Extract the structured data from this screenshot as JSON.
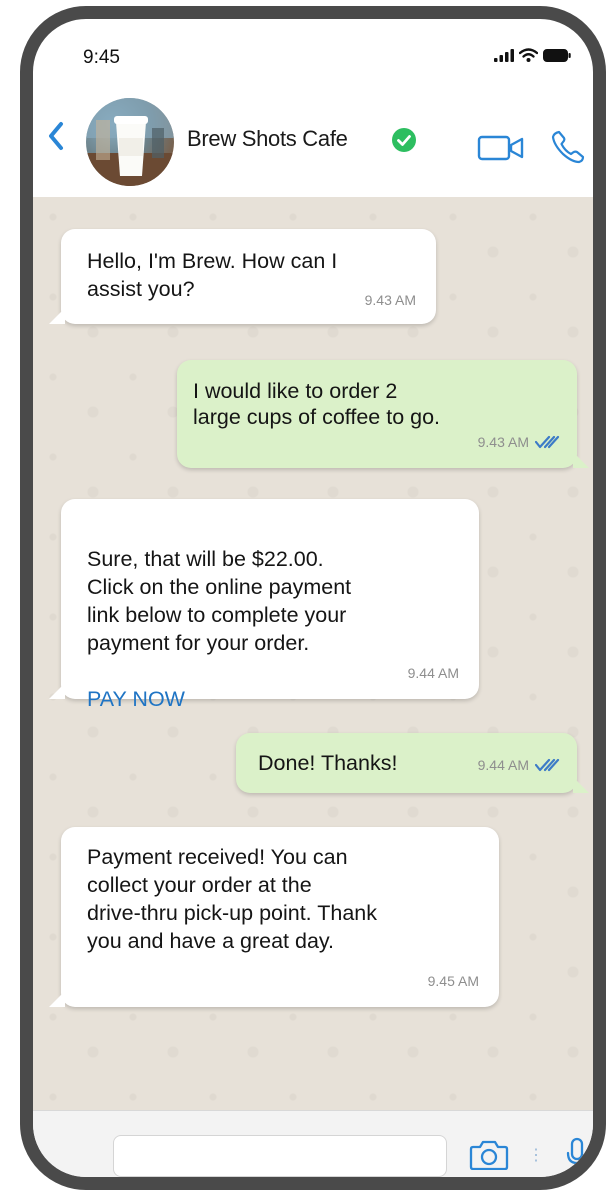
{
  "status_bar": {
    "time": "9:45"
  },
  "header": {
    "contact_name": "Brew Shots Cafe",
    "verified": true
  },
  "messages": [
    {
      "direction": "incoming",
      "text": "Hello, I'm Brew. How can I\nassist you?",
      "time": "9.43 AM"
    },
    {
      "direction": "outgoing",
      "text": "I would like to order 2\nlarge cups of coffee to go.",
      "time": "9.43 AM",
      "status": "read"
    },
    {
      "direction": "incoming",
      "text": "Sure, that will be $22.00.\nClick on the online payment\nlink below to complete your\npayment for your order.",
      "link": "PAY NOW",
      "time": "9.44 AM"
    },
    {
      "direction": "outgoing",
      "text": "Done! Thanks!",
      "time": "9.44 AM",
      "status": "read"
    },
    {
      "direction": "incoming",
      "text": "Payment received! You can\ncollect your order at the\ndrive-thru pick-up point. Thank\nyou and have a great day.",
      "time": "9.45 AM"
    }
  ],
  "input": {
    "placeholder": "",
    "value": ""
  },
  "colors": {
    "accent_blue": "#2a86d6",
    "outgoing_bubble": "#dbf1c9",
    "verified_green": "#2dbe60",
    "chat_bg": "#e7e1d8"
  },
  "icons": [
    "back-icon",
    "verified-icon",
    "video-call-icon",
    "voice-call-icon",
    "camera-icon",
    "microphone-icon",
    "double-check-icon"
  ]
}
